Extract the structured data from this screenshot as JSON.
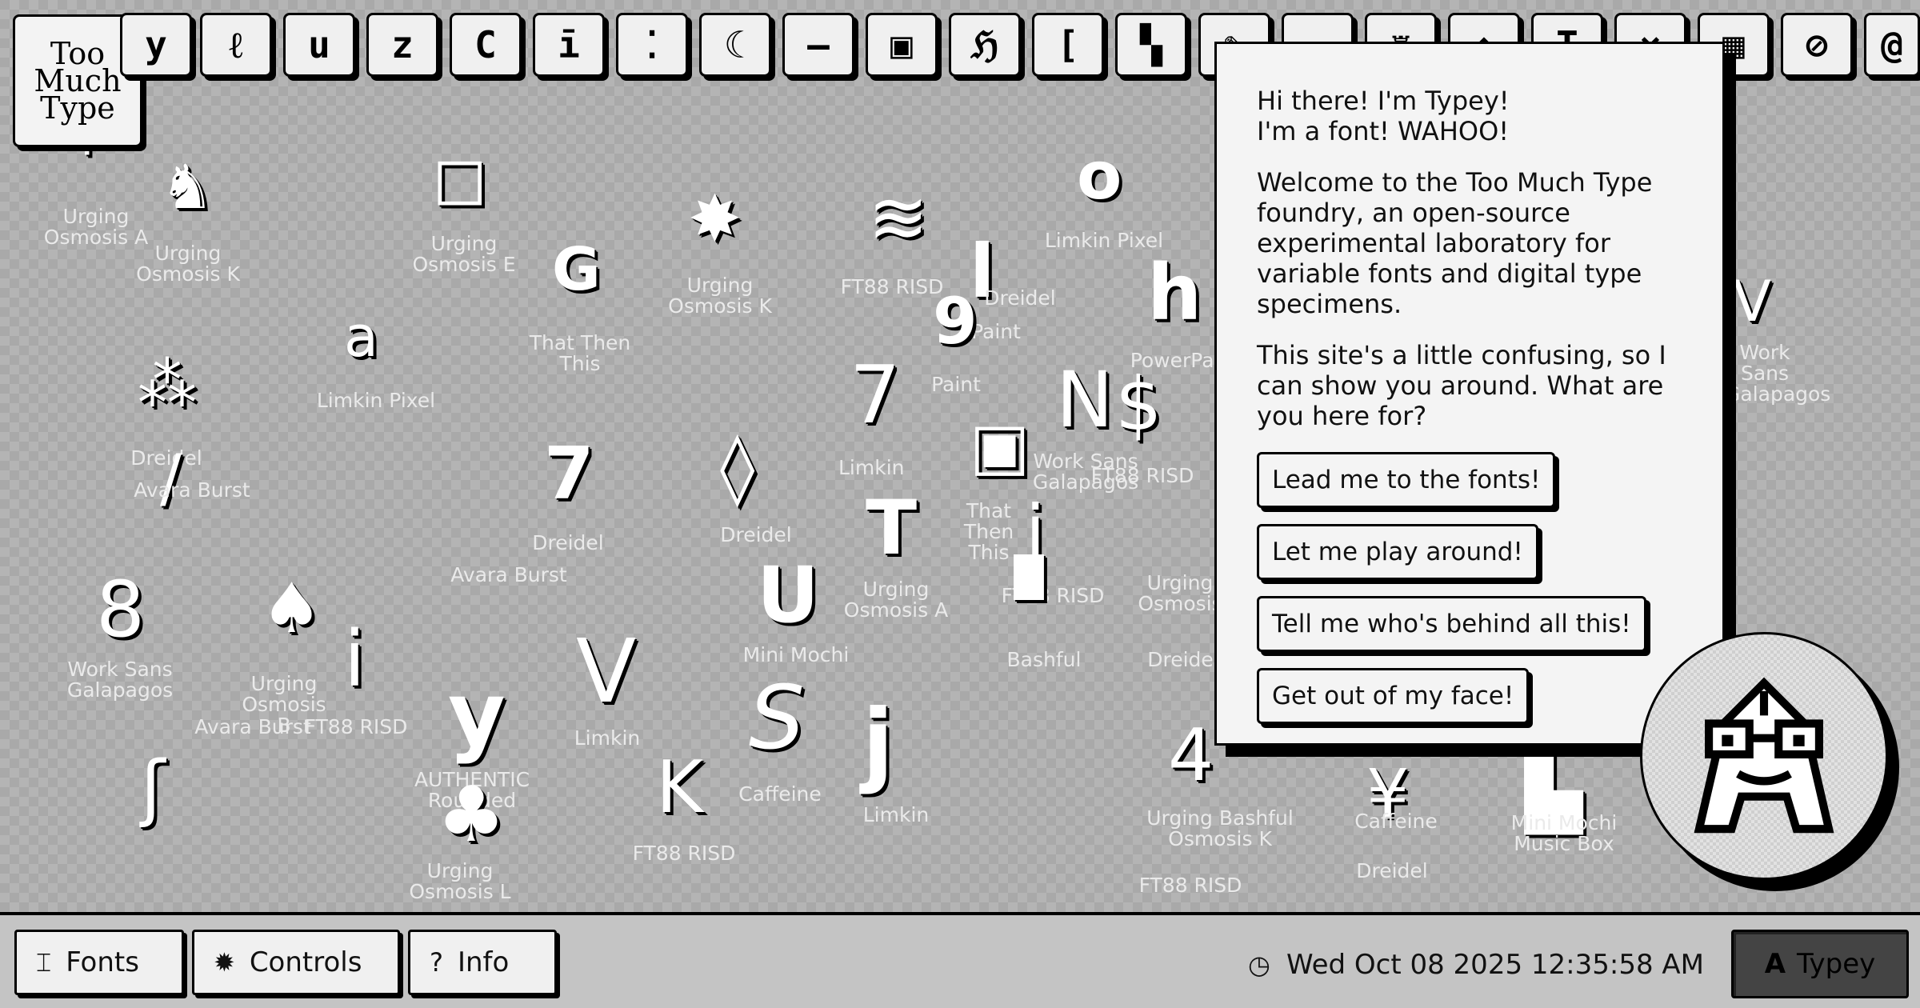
{
  "logo": {
    "lines": [
      "Too",
      "Much",
      "Type"
    ]
  },
  "key_strip": [
    "y",
    "ℓ",
    "u",
    "z",
    "C",
    "ī",
    "⁚",
    "☾",
    "—",
    "▣",
    "ℌ",
    "[",
    "▚",
    "✎",
    "~",
    "♜",
    "◆",
    "T",
    "×",
    "▦",
    "⊘",
    "@"
  ],
  "specimens": [
    {
      "glyph": "'",
      "label": "Urging\nOsmosis A"
    },
    {
      "glyph": "♞",
      "label": "Urging\nOsmosis K"
    },
    {
      "glyph": "◻",
      "label": "Urging\nOsmosis E"
    },
    {
      "glyph": "G",
      "label": "That Then\nThis"
    },
    {
      "glyph": "✸",
      "label": "Urging\nOsmosis K"
    },
    {
      "glyph": "≋",
      "label": "FT88 RISD"
    },
    {
      "glyph": "o",
      "label": "Limkin Pixel"
    },
    {
      "glyph": "l",
      "label": "Paint"
    },
    {
      "glyph": "9",
      "label": "Paint"
    },
    {
      "glyph": "h",
      "label": "PowerPac"
    },
    {
      "glyph": "a",
      "label": "Limkin Pixel"
    },
    {
      "glyph": "⁂",
      "label": "Dreidel"
    },
    {
      "glyph": "7",
      "label": "Dreidel"
    },
    {
      "glyph": "◊",
      "label": "Dreidel"
    },
    {
      "glyph": "7",
      "label": "Limkin"
    },
    {
      "glyph": "▣",
      "label": "That Then\nThis"
    },
    {
      "glyph": "N",
      "label": "Work Sans\nGalapagos"
    },
    {
      "glyph": "$",
      "label": "FT88 RISD"
    },
    {
      "glyph": "/",
      "label": "Avara Burst"
    },
    {
      "glyph": "T",
      "label": "Urging\nOsmosis A"
    },
    {
      "glyph": "U",
      "label": "Mini Mochi"
    },
    {
      "glyph": "i",
      "label": "FT88 RISD"
    },
    {
      "glyph": "▘",
      "label": "Bashful"
    },
    {
      "glyph": "8",
      "label": "Work Sans\nGalapagos"
    },
    {
      "glyph": "♠",
      "label": "Urging\nOsmosis B"
    },
    {
      "glyph": "i",
      "label": "FT88 RISD"
    },
    {
      "glyph": "V",
      "label": "Limkin"
    },
    {
      "glyph": "y",
      "label": "AUTHENTIC\nRounded"
    },
    {
      "glyph": "S",
      "label": "Caffeine"
    },
    {
      "glyph": "j",
      "label": "Limkin"
    },
    {
      "glyph": "K",
      "label": "FT88 RISD"
    },
    {
      "glyph": "♣",
      "label": "Urging\nOsmosis L"
    },
    {
      "glyph": "4",
      "label": "Urging Bashful\nOsmosis K"
    },
    {
      "glyph": "¥",
      "label": "Caffeine"
    },
    {
      "glyph": "▙",
      "label": "Mini Mochi\nMusic Box"
    },
    {
      "glyph": "V",
      "label": "Work Sans\nGalapagos"
    },
    {
      "glyph": "ʃ",
      "label": "Avara Burst"
    }
  ],
  "extra_labels": [
    "Dreidel",
    "Urging\nOsmosis",
    "FT88 RISD",
    "Dreidel",
    "Avara Burst",
    "Dreidel"
  ],
  "dialog": {
    "greeting_line1": "Hi there! I'm Typey!",
    "greeting_line2": "I'm a font! WAHOO!",
    "welcome": "Welcome to the Too Much Type foundry, an open-source experimental laboratory for variable fonts and digital type specimens.",
    "question": "This site's a little confusing, so I can show you around. What are you here for?",
    "buttons": [
      "Lead me to the fonts!",
      "Let me play around!",
      "Tell me who's behind all this!",
      "Get out of my face!"
    ]
  },
  "taskbar": {
    "fonts_label": "Fonts",
    "controls_label": "Controls",
    "info_label": "Info",
    "datetime": "Wed Oct 08 2025 12:35:58 AM",
    "typey_label": "Typey",
    "typey_glyph": "A",
    "fonts_icon": "text-cursor-icon",
    "controls_icon": "sun-gear-icon",
    "info_icon": "question-icon",
    "clock_icon": "clock-icon"
  }
}
